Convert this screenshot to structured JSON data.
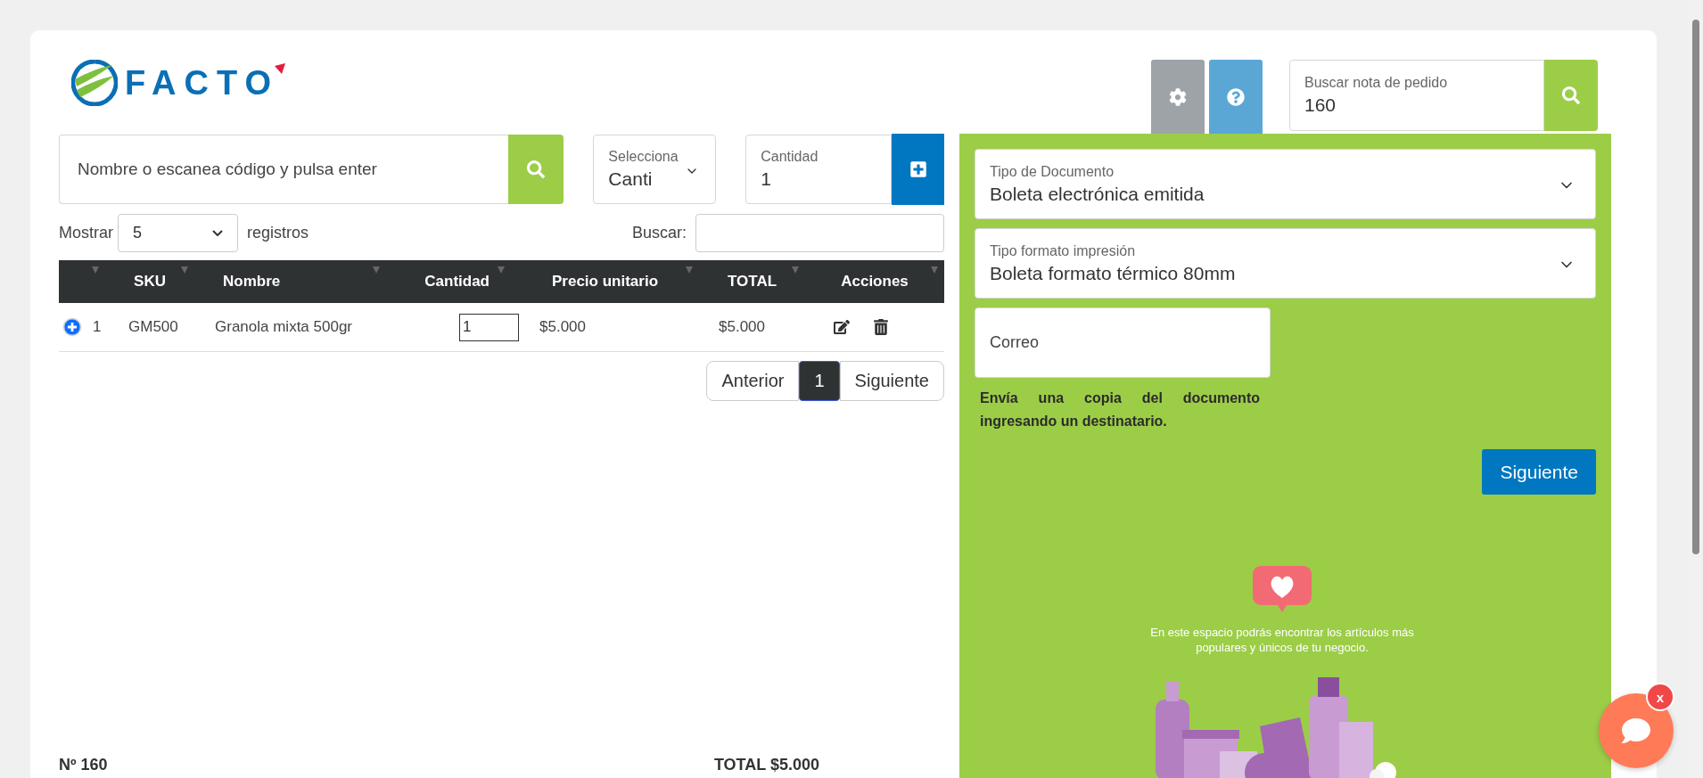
{
  "logo": {
    "text": "FACTO"
  },
  "order_search": {
    "label": "Buscar nota de pedido",
    "value": "160"
  },
  "product_search": {
    "placeholder": "Nombre o escanea código y pulsa enter"
  },
  "unit_select": {
    "label": "Selecciona",
    "value": "Canti"
  },
  "quantity": {
    "label": "Cantidad",
    "value": "1"
  },
  "table_controls": {
    "show_label": "Mostrar",
    "page_size": "5",
    "records_label": "registros",
    "search_label": "Buscar:"
  },
  "table": {
    "columns": [
      "",
      "SKU",
      "Nombre",
      "Cantidad",
      "Precio unitario",
      "TOTAL",
      "Acciones"
    ],
    "rows": [
      {
        "index": "1",
        "sku": "GM500",
        "name": "Granola mixta 500gr",
        "quantity": "1",
        "unit_price": "$5.000",
        "total": "$5.000"
      }
    ]
  },
  "pagination": {
    "previous": "Anterior",
    "pages": [
      {
        "label": "1",
        "selected": true
      }
    ],
    "next": "Siguiente"
  },
  "summary": {
    "number": "Nº 160",
    "total": "TOTAL $5.000"
  },
  "document_panel": {
    "document_type": {
      "label": "Tipo de Documento",
      "value": "Boleta electrónica emitida"
    },
    "print_format": {
      "label": "Tipo formato impresión",
      "value": "Boleta formato térmico 80mm"
    },
    "email": {
      "placeholder": "Correo"
    },
    "note": "Envía una copia del documento ingresando un destinatario.",
    "next_button": "Siguiente",
    "promo": {
      "text": "En este espacio podrás encontrar los artículos más populares y únicos de tu negocio."
    }
  },
  "chat": {
    "close": "x"
  }
}
